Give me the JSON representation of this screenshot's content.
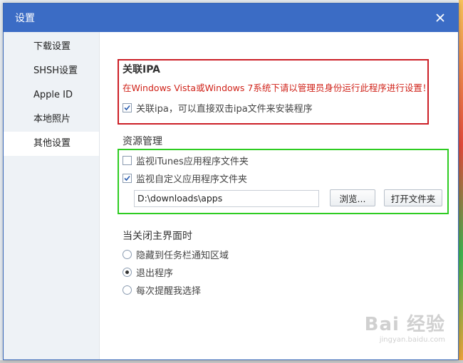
{
  "dialog": {
    "title": "设置",
    "close_icon": "close-icon"
  },
  "sidebar": {
    "items": [
      {
        "label": "下载设置",
        "active": false
      },
      {
        "label": "SHSH设置",
        "active": false
      },
      {
        "label": "Apple ID",
        "active": false
      },
      {
        "label": "本地照片",
        "active": false
      },
      {
        "label": "其他设置",
        "active": true
      }
    ]
  },
  "association": {
    "title": "关联IPA",
    "warning": "在Windows Vista或Windows 7系统下请以管理员身份运行此程序进行设置！",
    "checkbox_label": "关联ipa，可以直接双击ipa文件来安装程序",
    "checked": true
  },
  "resources": {
    "title": "资源管理",
    "monitor_itunes": {
      "label": "监视iTunes应用程序文件夹",
      "checked": false
    },
    "monitor_custom": {
      "label": "监视自定义应用程序文件夹",
      "checked": true
    },
    "path_value": "D:\\downloads\\apps",
    "browse_label": "浏览...",
    "open_folder_label": "打开文件夹"
  },
  "on_close": {
    "title": "当关闭主界面时",
    "options": [
      {
        "label": "隐藏到任务栏通知区域",
        "selected": false
      },
      {
        "label": "退出程序",
        "selected": true
      },
      {
        "label": "每次提醒我选择",
        "selected": false
      }
    ]
  },
  "colors": {
    "titlebar": "#3b6cc5",
    "annotation_red": "#cc1f26",
    "annotation_green": "#2ecc22",
    "warning_text": "#d0231a"
  },
  "watermark": {
    "text": "Bai 经验",
    "sub": "jingyan.baidu.com"
  }
}
